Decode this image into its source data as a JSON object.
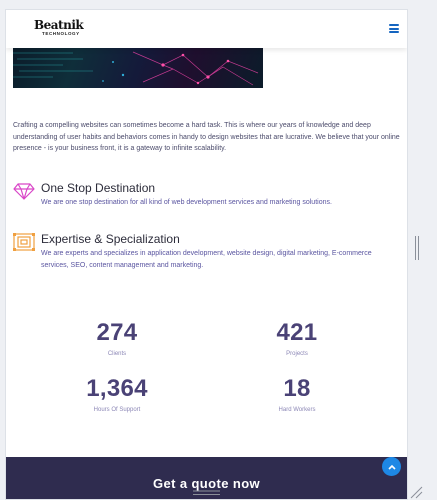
{
  "header": {
    "logo_main": "Beatnik",
    "logo_sub": "TECHNOLOGY",
    "menu_icon": "hamburger-menu-icon",
    "accent": "#1565c0"
  },
  "intro": "Crafting a compelling websites can sometimes become a hard task. This is where our years of knowledge and deep understanding of user habits and behaviors comes in handy to design websites that are lucrative. We believe that your online presence - is your business front, it is a gateway to infinite scalability.",
  "features": [
    {
      "icon": "diamond-icon",
      "icon_color": "#d946c8",
      "title": "One Stop Destination",
      "text": "We are one stop destination for all kind of web development services and marketing solutions."
    },
    {
      "icon": "expertise-icon",
      "icon_color": "#f0a040",
      "title": "Expertise & Specialization",
      "text": "We are experts and specializes in application development, website design, digital marketing, E-commerce services, SEO, content management and marketing."
    }
  ],
  "stats": [
    {
      "value": "274",
      "label": "Clients"
    },
    {
      "value": "421",
      "label": "Projects"
    },
    {
      "value": "1,364",
      "label": "Hours Of Support"
    },
    {
      "value": "18",
      "label": "Hard Workers"
    }
  ],
  "cta": {
    "label": "Get a quote now"
  },
  "scroll_top_icon": "chevron-up-icon",
  "colors": {
    "stat_number": "#4a4276",
    "cta_background": "#2f2c4f",
    "feature_text": "#5a55a0"
  }
}
